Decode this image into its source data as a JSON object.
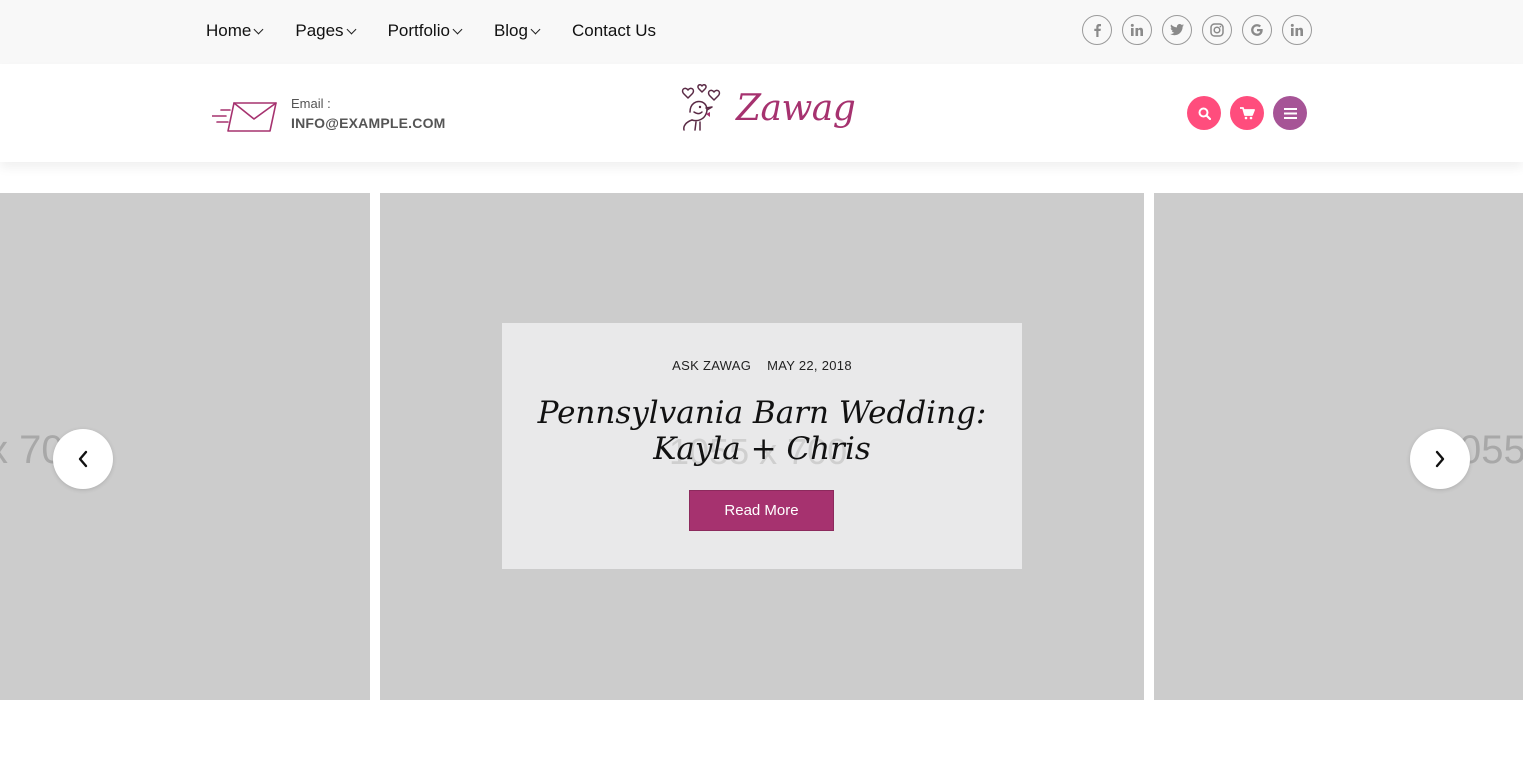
{
  "nav": {
    "items": [
      {
        "label": "Home",
        "dropdown": true
      },
      {
        "label": "Pages",
        "dropdown": true
      },
      {
        "label": "Portfolio",
        "dropdown": true
      },
      {
        "label": "Blog",
        "dropdown": true
      },
      {
        "label": "Contact Us",
        "dropdown": false
      }
    ]
  },
  "socials": [
    "facebook-icon",
    "linkedin-icon",
    "twitter-icon",
    "instagram-icon",
    "google-icon",
    "linkedin-icon"
  ],
  "header": {
    "email_label": "Email :",
    "email_value": "INFO@EXAMPLE.COM",
    "logo_text": "Zawag",
    "buttons": [
      {
        "icon": "search-icon",
        "color": "#ff4d7d"
      },
      {
        "icon": "cart-icon",
        "color": "#ff4d7d"
      },
      {
        "icon": "menu-icon",
        "color": "#a65496"
      }
    ]
  },
  "slider": {
    "left_placeholder": "x 70",
    "right_placeholder": "055",
    "center_placeholder": "1055 x 700",
    "category": "ASK ZAWAG",
    "date": "MAY 22, 2018",
    "title_line1": "Pennsylvania Barn Wedding:",
    "title_line2": "Kayla + Chris",
    "button_label": "Read More"
  },
  "colors": {
    "accent": "#a6326f",
    "pink": "#ff4d7d",
    "placeholder": "#cccccc"
  }
}
